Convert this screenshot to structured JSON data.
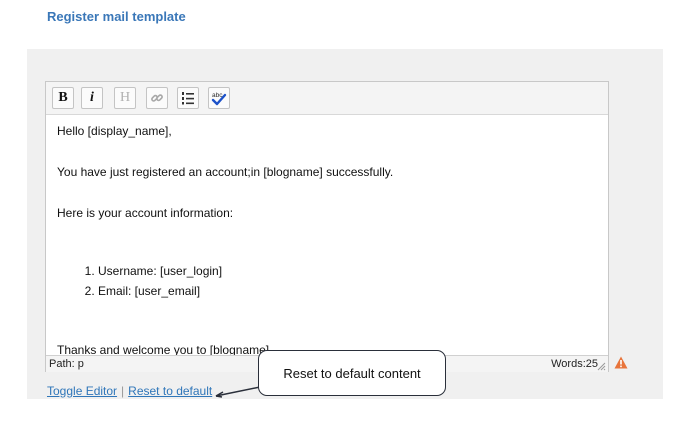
{
  "section": {
    "title": "Register mail template"
  },
  "toolbar": {
    "buttons": [
      {
        "name": "bold-button",
        "glyph": "B",
        "icon": "bold-icon"
      },
      {
        "name": "italic-button",
        "glyph": "i",
        "icon": "italic-icon"
      },
      {
        "name": "heading-button",
        "glyph": "H",
        "icon": "heading-icon"
      },
      {
        "name": "link-button",
        "glyph": "",
        "icon": "link-icon"
      },
      {
        "name": "ordered-list-button",
        "glyph": "",
        "icon": "ordered-list-icon"
      },
      {
        "name": "spellcheck-button",
        "glyph": "abc",
        "icon": "spellcheck-icon"
      }
    ]
  },
  "editor": {
    "greeting": "Hello [display_name],",
    "line1": "You have just registered an account;in [blogname] successfully.",
    "line2": "Here is your account information:",
    "list": [
      "Username: [user_login]",
      "Email: [user_email]"
    ],
    "closing": "Thanks and welcome you to [blogname].",
    "path": "Path: p",
    "words": "Words:25"
  },
  "links": {
    "toggle": "Toggle Editor",
    "separator": "|",
    "reset": "Reset to default"
  },
  "callout": {
    "text": "Reset to default content"
  },
  "colors": {
    "heading": "#3a77b8",
    "link": "#2f76b9",
    "warning": "#e8743b",
    "panel": "#f0f0f0"
  }
}
